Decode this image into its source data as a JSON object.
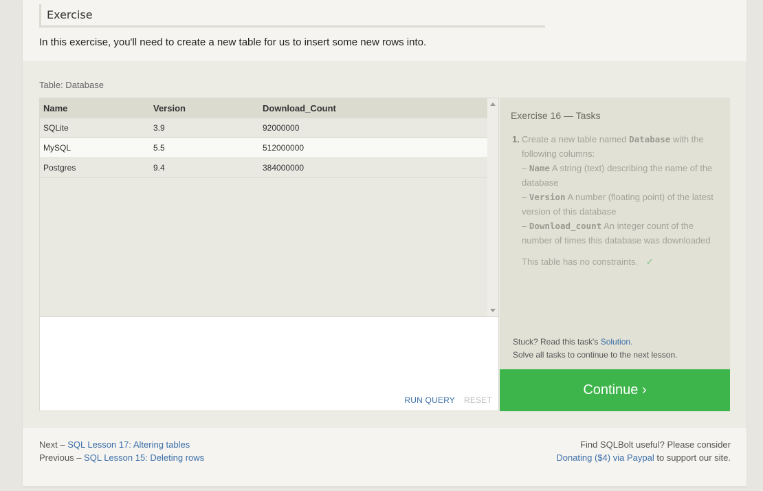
{
  "exercise_heading": "Exercise",
  "intro_text": "In this exercise, you'll need to create a new table for us to insert some new rows into.",
  "table_caption": "Table: Database",
  "results": {
    "columns": [
      "Name",
      "Version",
      "Download_Count"
    ],
    "rows": [
      [
        "SQLite",
        "3.9",
        "92000000"
      ],
      [
        "MySQL",
        "5.5",
        "512000000"
      ],
      [
        "Postgres",
        "9.4",
        "384000000"
      ]
    ]
  },
  "editor": {
    "run_label": "RUN QUERY",
    "reset_label": "RESET"
  },
  "tasks": {
    "title": "Exercise 16 — Tasks",
    "number": "1.",
    "intro": "Create a new table named",
    "table_name": "Database",
    "intro_tail": "with the following columns:",
    "columns": [
      {
        "dash": "–",
        "name": "Name",
        "desc": "A string (text) describing the name of the database"
      },
      {
        "dash": "–",
        "name": "Version",
        "desc": "A number (floating point) of the latest version of this database"
      },
      {
        "dash": "–",
        "name": "Download_count",
        "desc": "An integer count of the number of times this database was downloaded"
      }
    ],
    "constraints": "This table has no constraints.",
    "check_mark": "✓"
  },
  "help": {
    "stuck_prefix": "Stuck? Read this task's",
    "solution_link": "Solution.",
    "solve_all": "Solve all tasks to continue to the next lesson."
  },
  "continue_label": "Continue ›",
  "footer": {
    "next_prefix": "Next –",
    "next_link": "SQL Lesson 17: Altering tables",
    "prev_prefix": "Previous –",
    "prev_link": "SQL Lesson 15: Deleting rows",
    "right_line1": "Find SQLBolt useful? Please consider",
    "donate_link": "Donating ($4) via Paypal",
    "right_tail": "to support our site."
  }
}
